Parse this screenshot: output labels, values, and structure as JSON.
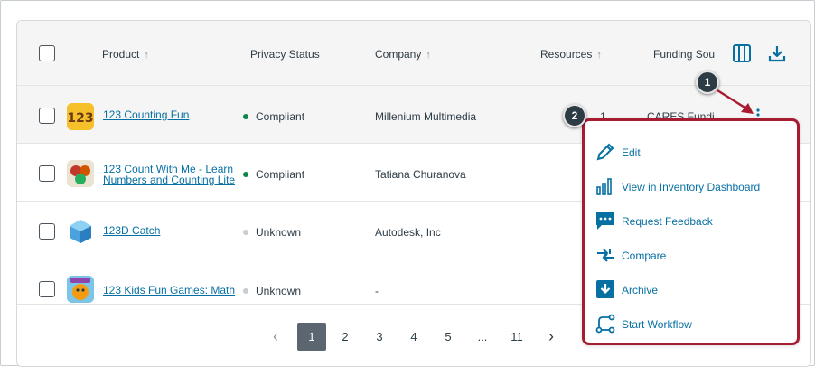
{
  "table": {
    "columns": {
      "product": "Product",
      "privacy": "Privacy Status",
      "company": "Company",
      "resources": "Resources",
      "funding": "Funding Sou"
    },
    "rows": [
      {
        "product": "123 Counting Fun",
        "status": "Compliant",
        "company": "Millenium Multimedia",
        "resources": "1",
        "funding": "CARES Fundi"
      },
      {
        "product_line1": "123 Count With Me - Learn",
        "product_line2": "Numbers and Counting Lite",
        "status": "Compliant",
        "company": "Tatiana Churanova"
      },
      {
        "product": "123D Catch",
        "status": "Unknown",
        "company": "Autodesk, Inc"
      },
      {
        "product": "123 Kids Fun Games: Math",
        "status": "Unknown",
        "company": "-"
      }
    ]
  },
  "pagination": {
    "prev": "‹",
    "pages": [
      "1",
      "2",
      "3",
      "4",
      "5",
      "...",
      "11"
    ],
    "next": "›",
    "current": "1"
  },
  "menu": {
    "items": [
      {
        "label": "Edit",
        "icon": "pencil-icon"
      },
      {
        "label": "View in Inventory Dashboard",
        "icon": "bar-chart-icon"
      },
      {
        "label": "Request Feedback",
        "icon": "chat-icon"
      },
      {
        "label": "Compare",
        "icon": "compare-arrows-icon"
      },
      {
        "label": "Archive",
        "icon": "archive-icon"
      },
      {
        "label": "Start Workflow",
        "icon": "workflow-icon"
      }
    ]
  },
  "callouts": {
    "one": "1",
    "two": "2"
  },
  "colors": {
    "accent": "#0770a3",
    "highlight_border": "#a81c32",
    "compliant": "#0b874b",
    "unknown": "#c7cdd1"
  }
}
